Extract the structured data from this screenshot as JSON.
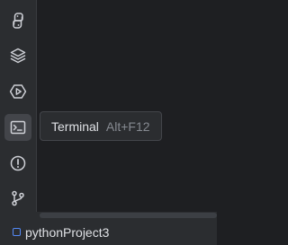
{
  "toolbar": {
    "buttons": [
      {
        "icon": "python-console-icon",
        "active": false
      },
      {
        "icon": "layers-icon",
        "active": false
      },
      {
        "icon": "services-icon",
        "active": false
      },
      {
        "icon": "terminal-icon",
        "active": true
      },
      {
        "icon": "problems-icon",
        "active": false
      },
      {
        "icon": "git-icon",
        "active": false
      }
    ]
  },
  "tooltip": {
    "label": "Terminal",
    "shortcut": "Alt+F12"
  },
  "status_bar": {
    "project_name": "pythonProject3"
  },
  "colors": {
    "toolbar_bg": "#2b2d30",
    "editor_bg": "#1e1f22",
    "icon": "#ced0d6",
    "active_bg": "#43454a",
    "accent": "#548af7"
  }
}
